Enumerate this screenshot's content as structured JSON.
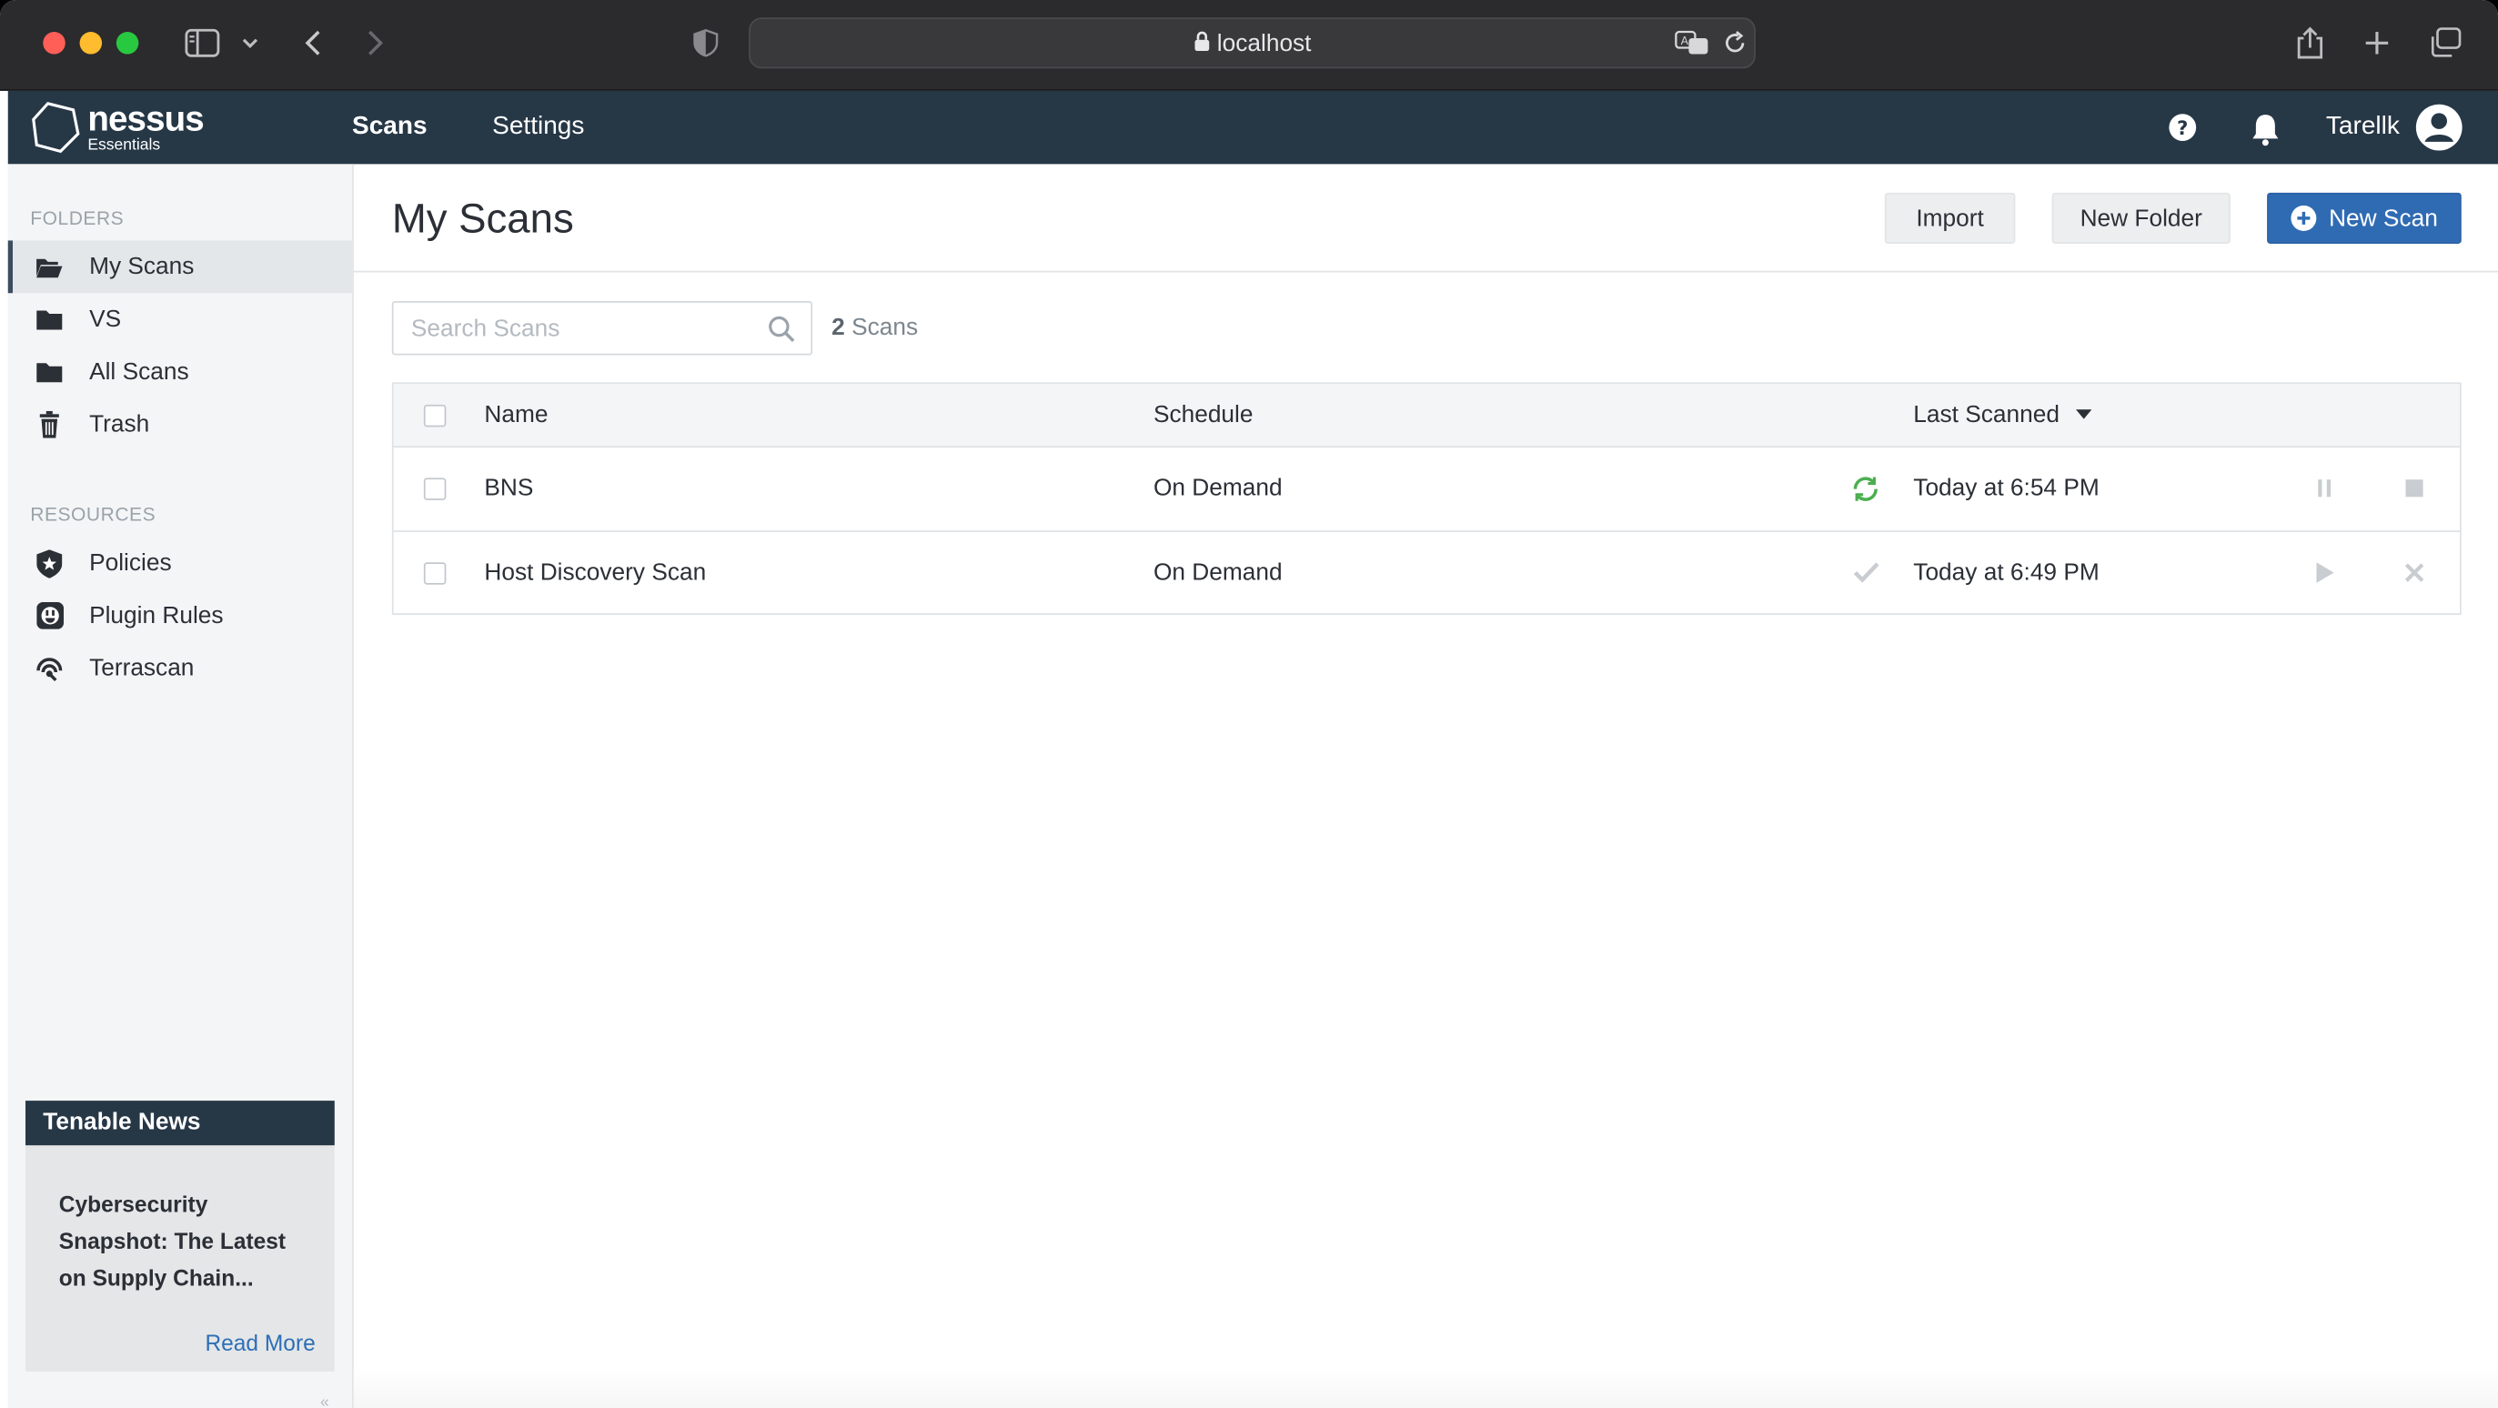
{
  "browser": {
    "url": "localhost",
    "tabs_icon": "tabs-overview-icon",
    "share_icon": "share-icon",
    "new_tab_icon": "plus-icon"
  },
  "header": {
    "brand": "nessus",
    "edition": "Essentials",
    "nav": [
      {
        "label": "Scans"
      },
      {
        "label": "Settings"
      }
    ],
    "username": "Tarellk"
  },
  "sidebar": {
    "folders_title": "FOLDERS",
    "folders": [
      {
        "label": "My Scans",
        "icon": "folder-open-icon"
      },
      {
        "label": "VS",
        "icon": "folder-icon"
      },
      {
        "label": "All Scans",
        "icon": "folder-icon"
      },
      {
        "label": "Trash",
        "icon": "trash-icon"
      }
    ],
    "resources_title": "RESOURCES",
    "resources": [
      {
        "label": "Policies",
        "icon": "shield-star-icon"
      },
      {
        "label": "Plugin Rules",
        "icon": "plugin-icon"
      },
      {
        "label": "Terrascan",
        "icon": "radar-icon"
      }
    ]
  },
  "news": {
    "title": "Tenable News",
    "body": "Cybersecurity Snapshot: The Latest on Supply Chain...",
    "link": "Read More"
  },
  "main": {
    "title": "My Scans",
    "buttons": {
      "import": "Import",
      "new_folder": "New Folder",
      "new_scan": "New Scan"
    },
    "search_placeholder": "Search Scans",
    "count_number": "2",
    "count_label": "Scans",
    "columns": {
      "name": "Name",
      "schedule": "Schedule",
      "last_scanned": "Last Scanned"
    },
    "rows": [
      {
        "name": "BNS",
        "schedule": "On Demand",
        "status_icon": "running-icon",
        "last_scanned": "Today at 6:54 PM"
      },
      {
        "name": "Host Discovery Scan",
        "schedule": "On Demand",
        "status_icon": "completed-check-icon",
        "last_scanned": "Today at 6:49 PM"
      }
    ]
  },
  "colors": {
    "nav_bg": "#263746",
    "primary": "#2f6bb3",
    "running": "#4cae4f"
  }
}
